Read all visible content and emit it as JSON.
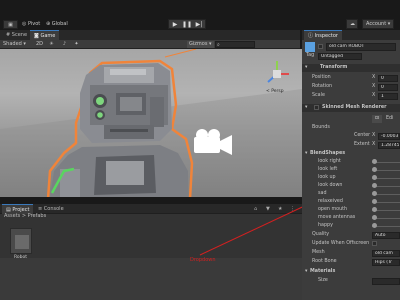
{
  "toolbar": {
    "pivot": "Pivot",
    "global": "Global",
    "account": "Account"
  },
  "scene": {
    "tab_scene": "Scene",
    "tab_game": "Game",
    "shading": "Shaded",
    "mode_2d": "2D",
    "gizmos": "Gizmos",
    "persp": "< Persp"
  },
  "project": {
    "tab_project": "Project",
    "tab_console": "Console",
    "breadcrumb": "Assets > Prefabs",
    "asset_name": "Robot"
  },
  "annotation": {
    "label": "Dropdown",
    "color": "#d42020"
  },
  "inspector": {
    "tab": "Inspector",
    "object_name": "old cam ROBOT",
    "tag_label": "Tag",
    "tag_value": "Untagged",
    "transform": {
      "title": "Transform",
      "position": "Position",
      "rotation": "Rotation",
      "scale": "Scale",
      "pos_x": "X",
      "pos_x_val": "0",
      "rot_x": "X",
      "rot_x_val": "0",
      "scale_x": "X",
      "scale_x_val": "1"
    },
    "smr": {
      "title": "Skinned Mesh Renderer",
      "edit_label": "Edi",
      "bounds": "Bounds",
      "center": "Center",
      "center_x": "X",
      "center_val": "-0.0003",
      "extent": "Extent",
      "extent_x": "X",
      "extent_val": "1.28745"
    },
    "blendshapes": {
      "title": "BlendShapes",
      "items": [
        "look right",
        "look left",
        "look up",
        "look down",
        "sad",
        "relaxeived",
        "open mouth",
        "move antennas",
        "happy"
      ]
    },
    "quality_label": "Quality",
    "quality_value": "Auto",
    "update_offscreen": "Update When Offscreen",
    "mesh_label": "Mesh",
    "mesh_value": "old cam",
    "rootbone_label": "Root Bone",
    "rootbone_value": "Hips (Tr",
    "materials_label": "Materials",
    "size_label": "Size"
  },
  "colors": {
    "selection_outline": "#f0843a",
    "accent_blue": "#3a79bb",
    "robot_eye": "#7ed67e"
  }
}
